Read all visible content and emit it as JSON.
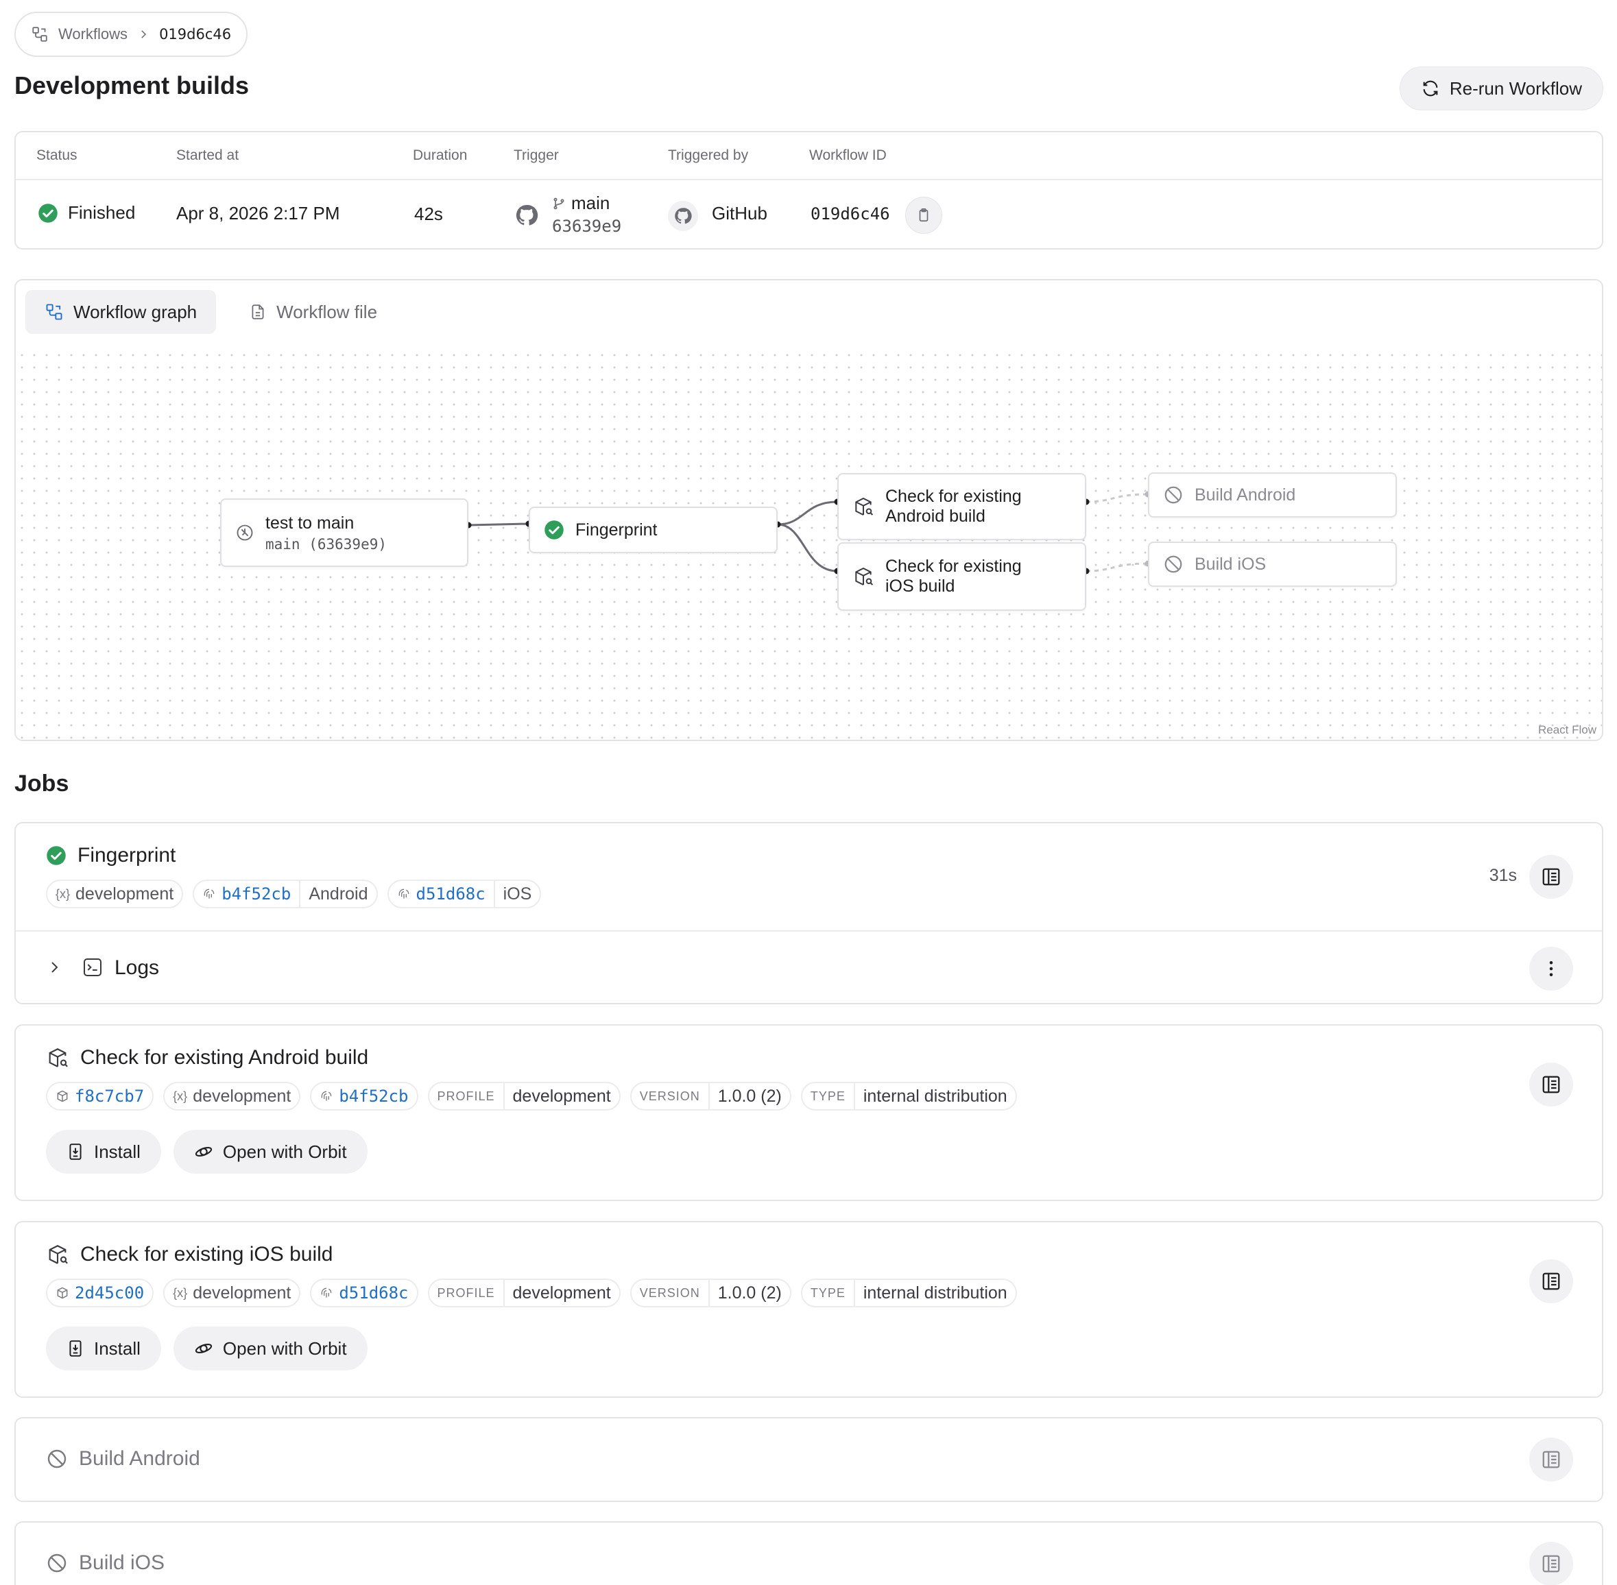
{
  "breadcrumb": {
    "parent": "Workflows",
    "current": "019d6c46"
  },
  "page": {
    "title": "Development builds",
    "rerun_label": "Re-run Workflow"
  },
  "summary": {
    "headers": {
      "status": "Status",
      "started_at": "Started at",
      "duration": "Duration",
      "trigger": "Trigger",
      "triggered_by": "Triggered by",
      "workflow_id": "Workflow ID"
    },
    "status": "Finished",
    "started_at": "Apr 8, 2026 2:17 PM",
    "duration": "42s",
    "trigger_branch": "main",
    "trigger_commit": "63639e9",
    "triggered_by": "GitHub",
    "workflow_id": "019d6c46"
  },
  "graph": {
    "tabs": {
      "graph": "Workflow graph",
      "file": "Workflow file"
    },
    "nodes": {
      "trigger_title": "test to main",
      "trigger_sub": "main (63639e9)",
      "fingerprint": "Fingerprint",
      "check_android_l1": "Check for existing",
      "check_android_l2": "Android build",
      "check_ios_l1": "Check for existing",
      "check_ios_l2": "iOS build",
      "build_android": "Build Android",
      "build_ios": "Build iOS"
    },
    "attribution": "React Flow"
  },
  "jobs": {
    "title": "Jobs",
    "fingerprint": {
      "name": "Fingerprint",
      "duration": "31s",
      "env": "development",
      "android_hash": "b4f52cb",
      "android_label": "Android",
      "ios_hash": "d51d68c",
      "ios_label": "iOS",
      "logs_label": "Logs"
    },
    "check_android": {
      "name": "Check for existing Android build",
      "build_id": "f8c7cb7",
      "env": "development",
      "fingerprint": "b4f52cb",
      "profile_label": "PROFILE",
      "profile": "development",
      "version_label": "VERSION",
      "version": "1.0.0 (2)",
      "type_label": "TYPE",
      "type": "internal distribution",
      "install_label": "Install",
      "orbit_label": "Open with Orbit"
    },
    "check_ios": {
      "name": "Check for existing iOS build",
      "build_id": "2d45c00",
      "env": "development",
      "fingerprint": "d51d68c",
      "profile_label": "PROFILE",
      "profile": "development",
      "version_label": "VERSION",
      "version": "1.0.0 (2)",
      "type_label": "TYPE",
      "type": "internal distribution",
      "install_label": "Install",
      "orbit_label": "Open with Orbit"
    },
    "build_android": {
      "name": "Build Android"
    },
    "build_ios": {
      "name": "Build iOS"
    }
  },
  "colors": {
    "success": "#2f9e5b",
    "link": "#1f6fc7",
    "muted": "#6b6b72"
  },
  "icons": [
    "workflow-icon",
    "chevron-right-icon",
    "refresh-icon",
    "check-circle-icon",
    "github-icon",
    "branch-icon",
    "clipboard-icon",
    "file-icon",
    "trigger-icon",
    "package-search-icon",
    "skip-icon",
    "variable-icon",
    "fingerprint-icon",
    "cube-icon",
    "logs-panel-icon",
    "terminal-icon",
    "more-vertical-icon",
    "install-icon",
    "orbit-icon"
  ]
}
